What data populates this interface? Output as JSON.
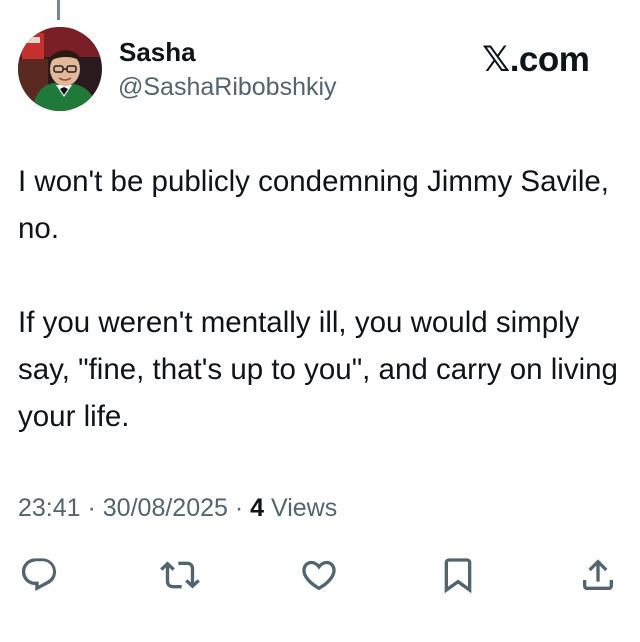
{
  "author": {
    "display_name": "Sasha",
    "handle": "@SashaRibobshkiy"
  },
  "brand": {
    "x_glyph": "𝕏",
    "domain": ".com"
  },
  "tweet": {
    "paragraphs": [
      "I won't be publicly condemning Jimmy Savile, no.",
      "If you weren't mentally ill, you would simply say, \"fine, that's up to you\", and carry on living your life."
    ]
  },
  "meta": {
    "time": "23:41",
    "separator": " · ",
    "date": "30/08/2025",
    "views_count": "4",
    "views_label": " Views"
  },
  "actions": {
    "reply": "reply-icon",
    "repost": "repost-icon",
    "like": "heart-icon",
    "bookmark": "bookmark-icon",
    "share": "share-icon"
  },
  "colors": {
    "text": "#0f1419",
    "secondary": "#536471"
  }
}
